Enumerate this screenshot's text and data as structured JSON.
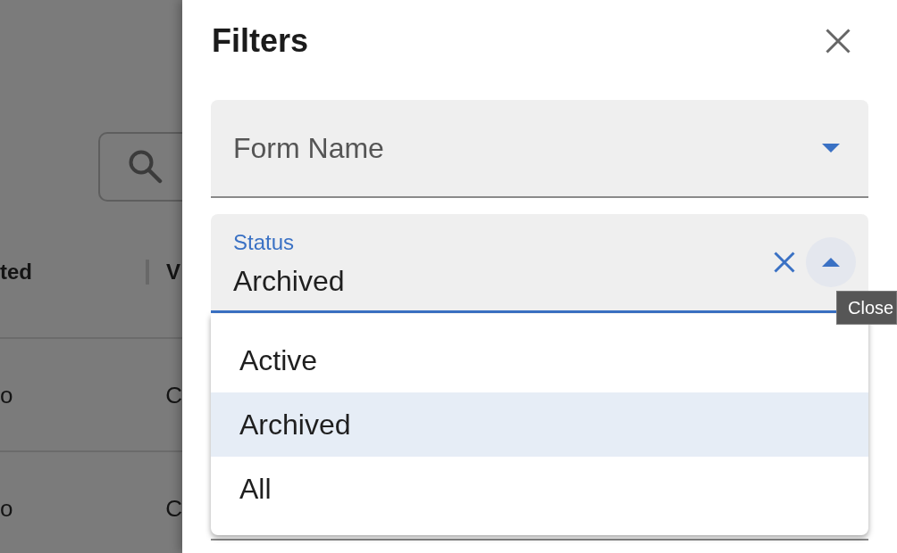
{
  "page": {
    "table": {
      "columns": [
        {
          "label": "ted"
        },
        {
          "label": "V"
        }
      ],
      "rows": [
        {
          "cells": [
            "o",
            "C"
          ]
        },
        {
          "cells": [
            "o",
            "C"
          ]
        }
      ]
    }
  },
  "filters_panel": {
    "title": "Filters",
    "fields": [
      {
        "label": "Form Name",
        "expanded": false
      },
      {
        "label": "Status",
        "value": "Archived",
        "expanded": true,
        "tooltip": "Close",
        "options": [
          {
            "label": "Active",
            "selected": false
          },
          {
            "label": "Archived",
            "selected": true
          },
          {
            "label": "All",
            "selected": false
          }
        ]
      }
    ]
  }
}
